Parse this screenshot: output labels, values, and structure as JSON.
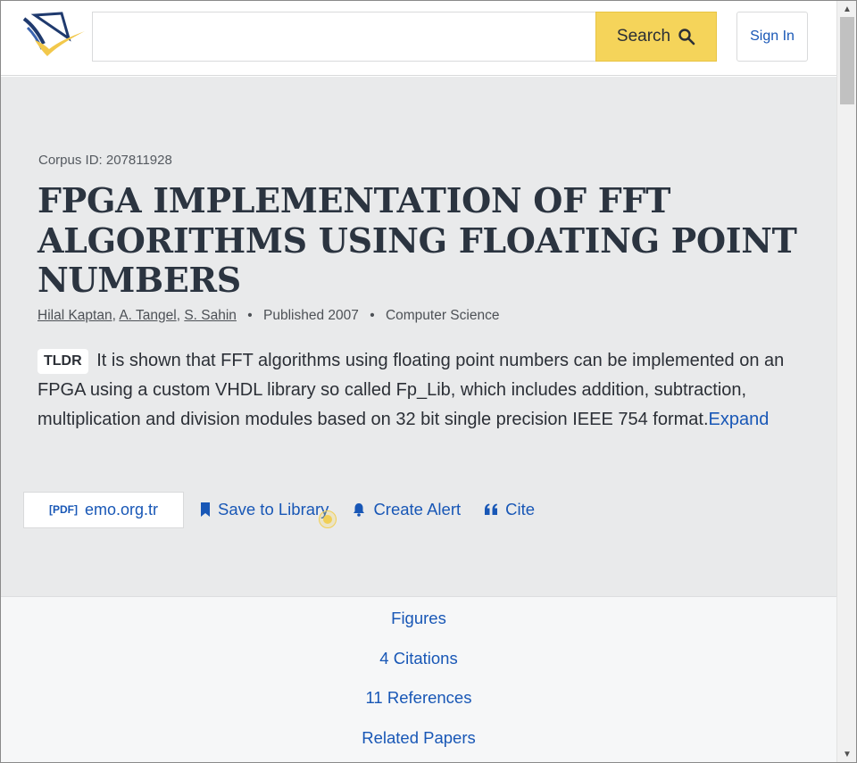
{
  "header": {
    "search_placeholder": "",
    "search_label": "Search",
    "signin_label": "Sign In"
  },
  "paper": {
    "corpus_id": "Corpus ID: 207811928",
    "title": "FPGA IMPLEMENTATION OF FFT ALGORITHMS USING FLOATING POINT NUMBERS",
    "authors": [
      "Hilal Kaptan",
      "A. Tangel",
      "S. Sahin"
    ],
    "published": "Published 2007",
    "field": "Computer Science",
    "tldr_label": "TLDR",
    "tldr_text": "It is shown that FFT algorithms using floating point numbers can be implemented on an FPGA using a custom VHDL library so called Fp_Lib, which includes addition, subtraction, multiplication and division modules based on 32 bit single precision IEEE 754 format.",
    "expand_label": "Expand"
  },
  "actions": {
    "pdf_tag": "[PDF]",
    "pdf_source": "emo.org.tr",
    "save_label": "Save to Library",
    "alert_label": "Create Alert",
    "cite_label": "Cite"
  },
  "nav": {
    "figures": "Figures",
    "citations": "4 Citations",
    "references": "11 References",
    "related": "Related Papers"
  },
  "colors": {
    "accent": "#1857b6",
    "search_button": "#f5d45a",
    "main_background": "#e9eaeb"
  }
}
